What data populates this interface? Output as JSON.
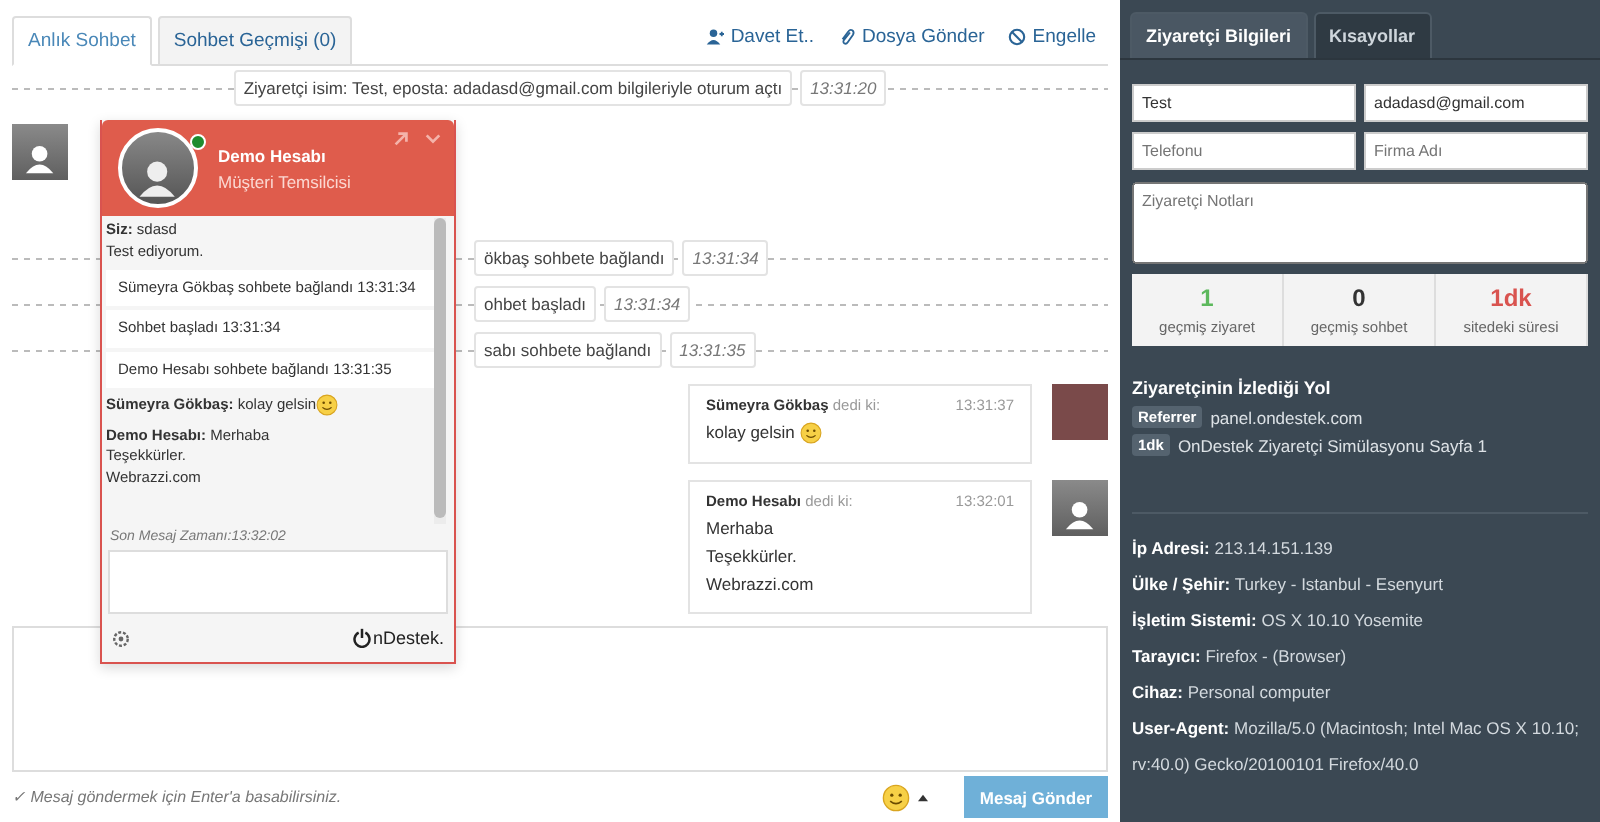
{
  "chat_tabs": [
    {
      "label": "Anlık Sohbet",
      "selected": true
    },
    {
      "label": "Sohbet Geçmişi (0)",
      "selected": false
    }
  ],
  "actions": [
    {
      "label": "Davet Et..",
      "kind": "invite"
    },
    {
      "label": "Dosya Gönder",
      "kind": "attach"
    },
    {
      "label": "Engelle",
      "kind": "block"
    }
  ],
  "events": [
    {
      "text": "Ziyaretçi isim: Test, eposta: adadasd@gmail.com bilgileriyle oturum açtı",
      "time": "13:31:20"
    },
    {
      "text": "ökbaş sohbete bağlandı",
      "time": "13:31:34"
    },
    {
      "text": "ohbet başladı",
      "time": "13:31:34"
    },
    {
      "text": "sabı sohbete bağlandı",
      "time": "13:31:35"
    }
  ],
  "messages": [
    {
      "author": "Sümeyra Gökbaş",
      "said": "dedi ki:",
      "time": "13:31:37",
      "lines": [
        "kolay gelsin"
      ],
      "emoji": true,
      "kind": "photo"
    },
    {
      "author": "Demo Hesabı",
      "said": "dedi ki:",
      "time": "13:32:01",
      "lines": [
        "Merhaba",
        "Teşekkürler.",
        "Webrazzi.com"
      ],
      "emoji": false,
      "kind": "silhouette"
    }
  ],
  "widget": {
    "name": "Demo Hesabı",
    "role": "Müşteri Temsilcisi",
    "online": true,
    "items": [
      {
        "kind": "message",
        "author": "Siz:",
        "text": "sdasd",
        "lines": [
          "Test ediyorum."
        ]
      },
      {
        "kind": "event",
        "text": "Sümeyra Gökbaş sohbete bağlandı 13:31:34"
      },
      {
        "kind": "event",
        "text": "Sohbet başladı 13:31:34"
      },
      {
        "kind": "event",
        "text": "Demo Hesabı sohbete bağlandı 13:31:35"
      },
      {
        "kind": "message",
        "author": "Sümeyra Gökbaş:",
        "text": "kolay gelsin",
        "emoji": true
      },
      {
        "kind": "message",
        "author": "Demo Hesabı:",
        "text": "Merhaba",
        "lines": [
          "Teşekkürler.",
          "Webrazzi.com"
        ]
      }
    ],
    "last_message": "Son Mesaj Zamanı:13:32:02",
    "logo": "nDestek."
  },
  "composer": {
    "hint": "✓ Mesaj göndermek için Enter'a basabilirsiniz.",
    "send": "Mesaj Gönder"
  },
  "side_tabs": [
    {
      "label": "Ziyaretçi Bilgileri",
      "selected": true
    },
    {
      "label": "Kısayollar",
      "selected": false
    }
  ],
  "visitor": {
    "fields": [
      {
        "value": "Test"
      },
      {
        "value": "adadasd@gmail.com"
      },
      {
        "placeholder": "Telefonu"
      },
      {
        "placeholder": "Firma Adı"
      }
    ],
    "notes_placeholder": "Ziyaretçi Notları",
    "stats": [
      {
        "value": "1",
        "label": "geçmiş ziyaret",
        "color": "#5cb85c"
      },
      {
        "value": "0",
        "label": "geçmiş sohbet",
        "color": "#333333"
      },
      {
        "value": "1dk",
        "label": "sitedeki süresi",
        "color": "#d9534f"
      }
    ]
  },
  "path": {
    "title": "Ziyaretçinin İzlediği Yol",
    "entries": [
      {
        "badge": "Referrer",
        "text": "panel.ondestek.com"
      },
      {
        "badge": "1dk",
        "text": "OnDestek Ziyaretçi Simülasyonu Sayfa 1"
      }
    ]
  },
  "details": [
    {
      "label": "İp Adresi:",
      "value": "213.14.151.139"
    },
    {
      "label": "Ülke / Şehir:",
      "value": "Turkey - Istanbul - Esenyurt"
    },
    {
      "label": "İşletim Sistemi:",
      "value": "OS X 10.10 Yosemite"
    },
    {
      "label": "Tarayıcı:",
      "value": "Firefox - (Browser)"
    },
    {
      "label": "Cihaz:",
      "value": "Personal computer"
    },
    {
      "label": "User-Agent:",
      "value": "Mozilla/5.0 (Macintosh; Intel Mac OS X 10.10; rv:40.0) Gecko/20100101 Firefox/40.0"
    }
  ]
}
